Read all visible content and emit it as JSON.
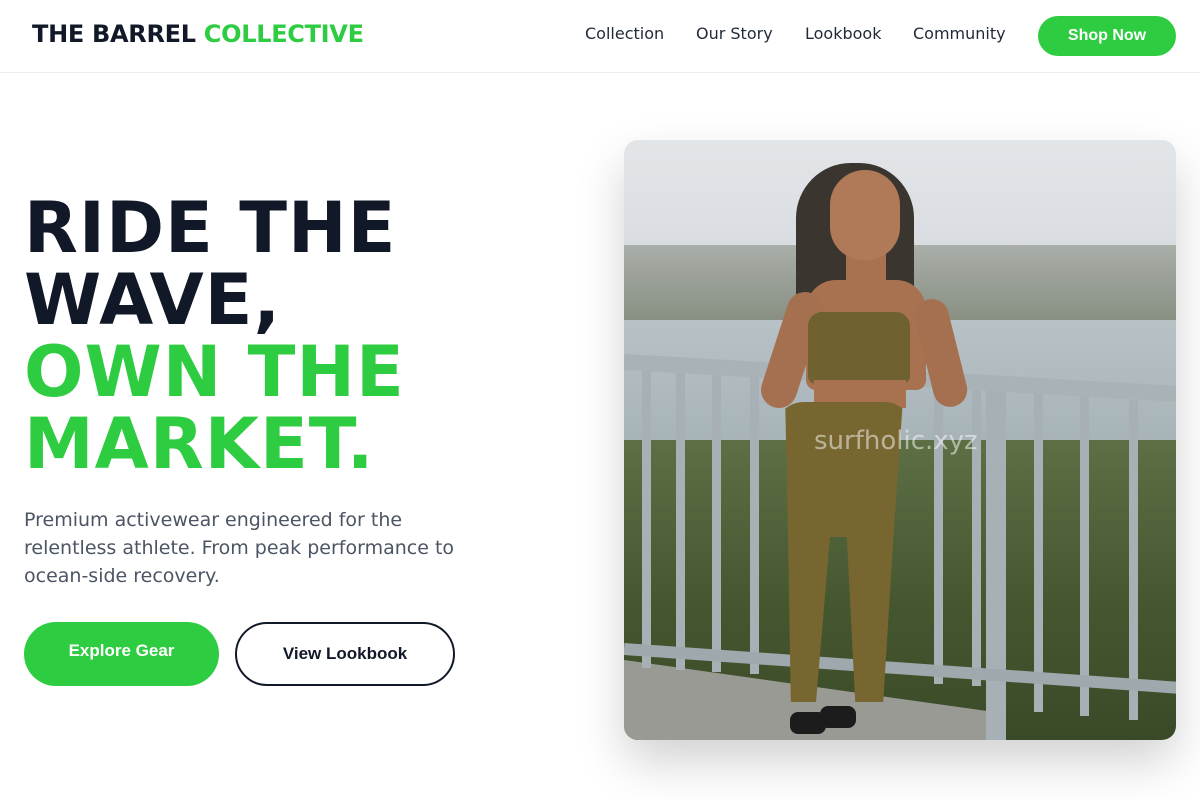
{
  "header": {
    "brand_part1": "THE BARREL",
    "brand_part2": "COLLECTIVE",
    "nav": [
      {
        "label": "Collection"
      },
      {
        "label": "Our Story"
      },
      {
        "label": "Lookbook"
      },
      {
        "label": "Community"
      }
    ],
    "cta_label": "Shop Now"
  },
  "hero": {
    "headline_line1": "RIDE THE",
    "headline_line2": "WAVE,",
    "headline_line3": "OWN THE",
    "headline_line4": "MARKET.",
    "subtext": "Premium activewear engineered for the relentless athlete. From peak performance to ocean-side recovery.",
    "primary_button": "Explore Gear",
    "secondary_button": "View Lookbook",
    "image_watermark": "surfholic.xyz"
  },
  "colors": {
    "accent": "#2ecc40",
    "text_dark": "#111827",
    "text_muted": "#4b5563"
  }
}
